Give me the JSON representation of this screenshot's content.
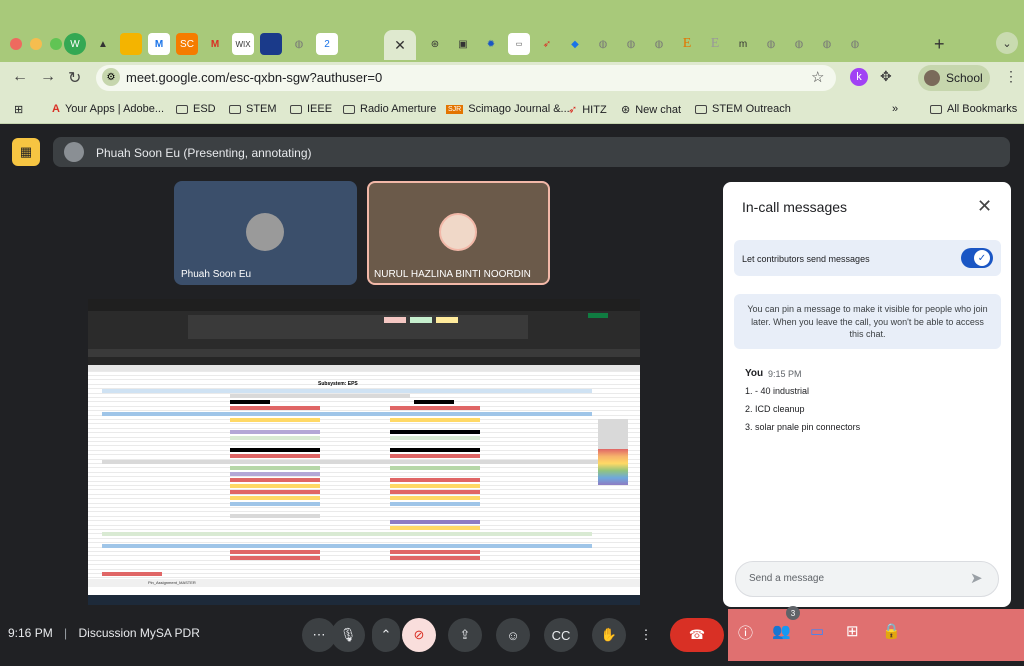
{
  "browser": {
    "url": "meet.google.com/esc-qxbn-sgw?authuser=0",
    "profile_label": "School",
    "profile_initial": "k",
    "bookmarks": [
      "Your Apps | Adobe...",
      "ESD",
      "STEM",
      "IEEE",
      "Radio Amerture",
      "Scimago Journal &...",
      "HITZ",
      "New chat",
      "STEM Outreach"
    ],
    "all_bookmarks": "All Bookmarks",
    "sjr_badge": "SJR"
  },
  "meet": {
    "presenter": "Phuah Soon Eu (Presenting, annotating)",
    "tiles": [
      {
        "name": "Phuah Soon Eu"
      },
      {
        "name": "NURUL HAZLINA BINTI NOORDIN"
      }
    ],
    "sheet_title": "Subsystem: EPS",
    "sheet_tabs": "Pin_Assignment_MASTER",
    "time": "9:16 PM",
    "meeting_name": "Discussion MySA PDR",
    "participant_count": "3"
  },
  "chat": {
    "title": "In-call messages",
    "toggle_label": "Let contributors send messages",
    "pin_info": "You can pin a message to make it visible for people who join later. When you leave the call, you won't be able to access this chat.",
    "sender": "You",
    "timestamp": "9:15 PM",
    "messages": [
      "1. - 40 industrial",
      "2. ICD cleanup",
      "3. solar pnale pin connectors"
    ],
    "send_placeholder": "Send a message"
  },
  "colors": {
    "chrome_green": "#a8c97a",
    "toolbar_green": "#dfe9cf",
    "meet_bg": "#202124",
    "end_call": "#d93025",
    "panel_accent": "#e07070"
  }
}
